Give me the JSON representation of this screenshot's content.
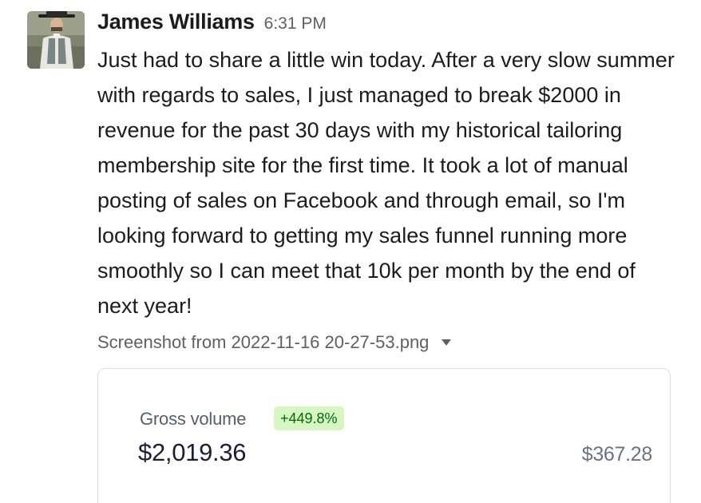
{
  "message": {
    "author": "James Williams",
    "timestamp": "6:31 PM",
    "text": "Just had to share a little win today. After a very slow summer with regards to sales, I just managed to break $2000 in revenue for the past 30 days with my historical tailoring membership site for the first time. It took a lot of manual posting of sales on Facebook and through email, so I'm looking forward to getting my sales funnel running more smoothly so I can meet that 10k per month by the end of next year!"
  },
  "attachment": {
    "file_name": "Screenshot from 2022-11-16 20-27-53.png",
    "caret_icon": "caret-down-icon",
    "preview": {
      "label": "Gross volume",
      "change": "+449.8%",
      "value": "$2,019.36",
      "previous_value": "$367.28"
    }
  },
  "colors": {
    "author": "#1d1c1d",
    "muted": "#616061",
    "badge_bg": "#d7f7c2",
    "badge_text": "#05690d"
  }
}
